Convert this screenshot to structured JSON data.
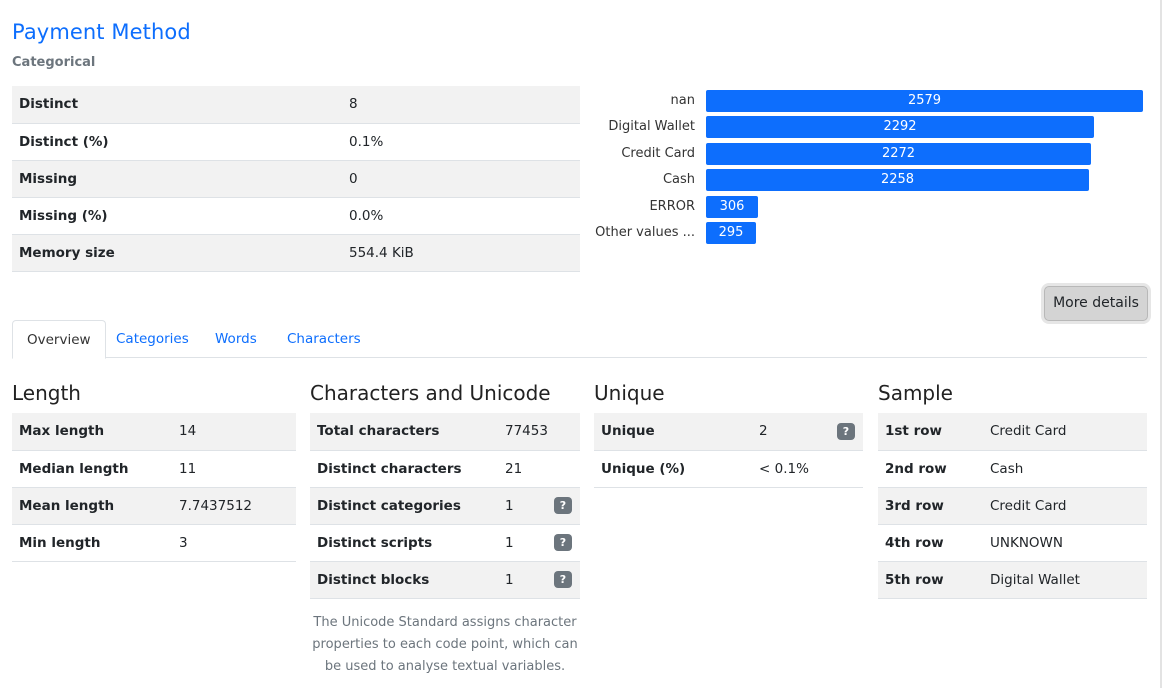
{
  "header": {
    "title": "Payment Method",
    "subtitle": "Categorical"
  },
  "stats": [
    {
      "label": "Distinct",
      "value": "8"
    },
    {
      "label": "Distinct (%)",
      "value": "0.1%"
    },
    {
      "label": "Missing",
      "value": "0"
    },
    {
      "label": "Missing (%)",
      "value": "0.0%"
    },
    {
      "label": "Memory size",
      "value": "554.4 KiB"
    }
  ],
  "chart_data": {
    "type": "bar",
    "orientation": "horizontal",
    "categories": [
      "nan",
      "Digital Wallet",
      "Credit Card",
      "Cash",
      "ERROR",
      "Other values ..."
    ],
    "values": [
      2579,
      2292,
      2272,
      2258,
      306,
      295
    ],
    "bar_color": "#0d6efd"
  },
  "more_details_label": "More details",
  "tabs": [
    "Overview",
    "Categories",
    "Words",
    "Characters"
  ],
  "length": {
    "title": "Length",
    "rows": [
      {
        "label": "Max length",
        "value": "14"
      },
      {
        "label": "Median length",
        "value": "11"
      },
      {
        "label": "Mean length",
        "value": "7.7437512"
      },
      {
        "label": "Min length",
        "value": "3"
      }
    ]
  },
  "characters": {
    "title": "Characters and Unicode",
    "rows": [
      {
        "label": "Total characters",
        "value": "77453",
        "help": ""
      },
      {
        "label": "Distinct characters",
        "value": "21",
        "help": ""
      },
      {
        "label": "Distinct categories",
        "value": "1",
        "help": "?"
      },
      {
        "label": "Distinct scripts",
        "value": "1",
        "help": "?"
      },
      {
        "label": "Distinct blocks",
        "value": "1",
        "help": "?"
      }
    ],
    "note": "The Unicode Standard assigns character properties to each code point, which can be used to analyse textual variables."
  },
  "unique": {
    "title": "Unique",
    "rows": [
      {
        "label": "Unique",
        "value": "2",
        "help": "?"
      },
      {
        "label": "Unique (%)",
        "value": "< 0.1%",
        "help": ""
      }
    ]
  },
  "sample": {
    "title": "Sample",
    "rows": [
      {
        "label": "1st row",
        "value": "Credit Card"
      },
      {
        "label": "2nd row",
        "value": "Cash"
      },
      {
        "label": "3rd row",
        "value": "Credit Card"
      },
      {
        "label": "4th row",
        "value": "UNKNOWN"
      },
      {
        "label": "5th row",
        "value": "Digital Wallet"
      }
    ]
  }
}
